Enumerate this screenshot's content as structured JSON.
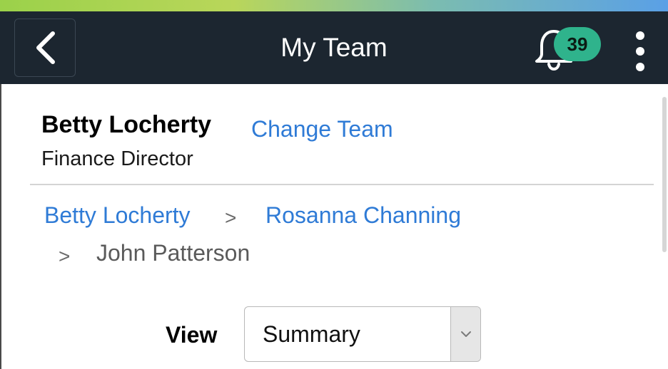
{
  "header": {
    "title": "My Team",
    "back_icon": "chevron-left-icon",
    "notifications_icon": "bell-icon",
    "notification_count": "39",
    "menu_icon": "kebab-menu-icon",
    "accent_gradient": [
      "#9bd14a",
      "#7bbcb0",
      "#5aa0e6"
    ],
    "background": "#1c2630",
    "badge_color": "#2fb38c"
  },
  "user": {
    "name": "Betty Locherty",
    "change_team_label": "Change Team",
    "job_title": "Finance Director"
  },
  "breadcrumb": {
    "separator": ">",
    "items": [
      {
        "label": "Betty Locherty",
        "link": true
      },
      {
        "label": "Rosanna Channing",
        "link": true
      },
      {
        "label": "John Patterson",
        "link": false
      }
    ]
  },
  "view": {
    "label": "View",
    "selected": "Summary"
  },
  "colors": {
    "link": "#2f7bd6"
  }
}
